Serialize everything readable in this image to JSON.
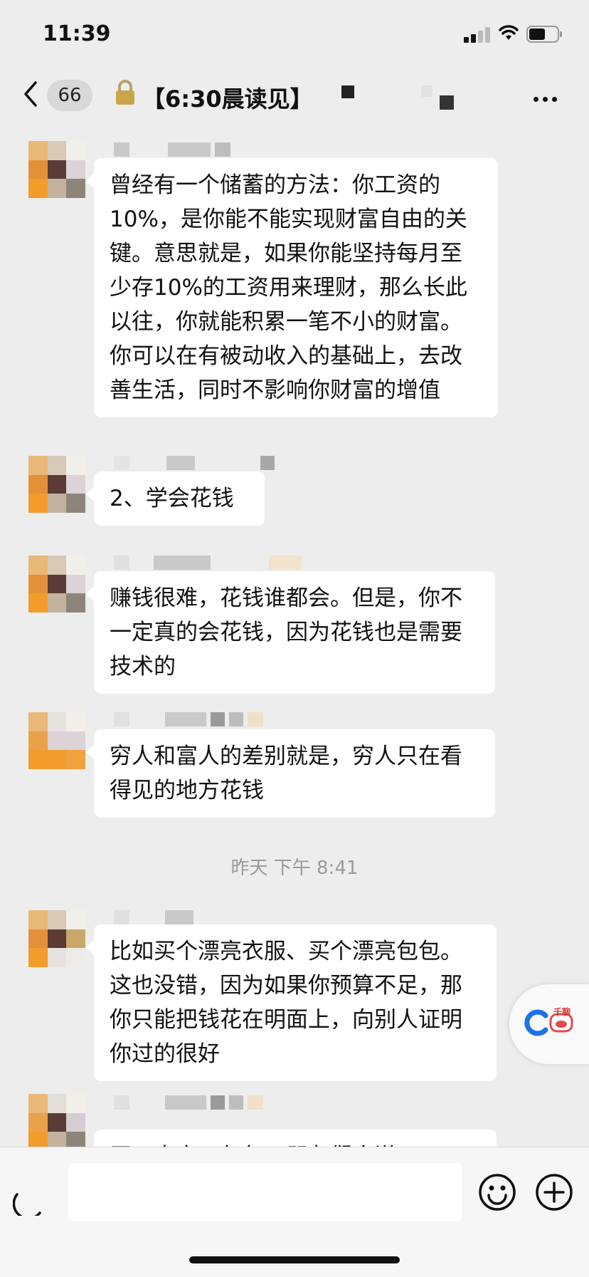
{
  "status_bar": {
    "time": "11:39"
  },
  "navbar": {
    "unread_count": "66",
    "title": "【6:30晨读见】"
  },
  "messages": [
    {
      "text": "曾经有一个储蓄的方法：你工资的10%，是你能不能实现财富自由的关键。意思就是，如果你能坚持每月至少存10%的工资用来理财，那么长此以往，你就能积累一笔不小的财富。你可以在有被动收入的基础上，去改善生活，同时不影响你财富的增值"
    },
    {
      "text": "2、学会花钱"
    },
    {
      "text": "赚钱很难，花钱谁都会。但是，你不一定真的会花钱，因为花钱也是需要技术的"
    },
    {
      "text": "穷人和富人的差别就是，穷人只在看得见的地方花钱"
    },
    {
      "text": "比如买个漂亮衣服、买个漂亮包包。这也没错，因为如果你预算不足，那你只能把钱花在明面上，向别人证明你过的很好"
    },
    {
      "text": "买了大衣、包包，朋友们会说："
    }
  ],
  "timestamp": "昨天 下午 8:41",
  "float_widget": {
    "label": "千聊"
  },
  "input": {
    "value": "",
    "placeholder": ""
  },
  "icons": {
    "back": "chevron-left-icon",
    "lock": "lock-icon",
    "more": "more-icon",
    "voice": "voice-icon",
    "emoji": "emoji-icon",
    "plus": "plus-icon"
  },
  "colors": {
    "background": "#ededed",
    "bubble": "#ffffff",
    "timestamp": "#9a9a9a",
    "lock": "#c8a54a"
  }
}
